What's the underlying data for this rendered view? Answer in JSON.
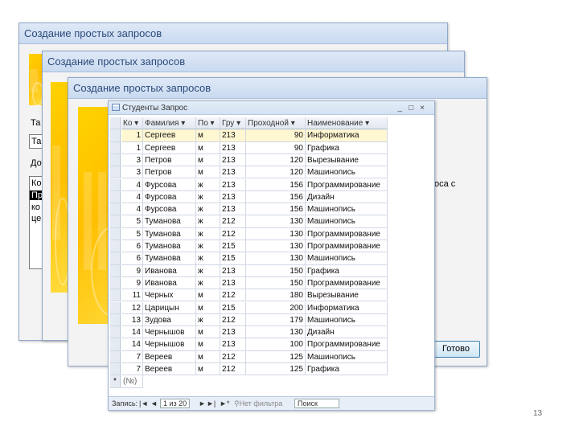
{
  "wizard": {
    "title": "Создание простых запросов",
    "finish_button": "Готово",
    "side_text": "оса с",
    "peek": [
      "Та",
      "Та",
      "До",
      "Ко",
      "Пр",
      "ко",
      "це"
    ]
  },
  "datasheet": {
    "title": "Студенты Запрос",
    "columns": [
      "Ко",
      "Фамилия",
      "По",
      "Гру",
      "Проходной",
      "Наименование"
    ],
    "rows": [
      {
        "k": "1",
        "fam": "Сергеев",
        "pol": "м",
        "grp": "213",
        "score": "90",
        "name": "Информатика"
      },
      {
        "k": "1",
        "fam": "Сергеев",
        "pol": "м",
        "grp": "213",
        "score": "90",
        "name": "Графика"
      },
      {
        "k": "3",
        "fam": "Петров",
        "pol": "м",
        "grp": "213",
        "score": "120",
        "name": "Вырезывание"
      },
      {
        "k": "3",
        "fam": "Петров",
        "pol": "м",
        "grp": "213",
        "score": "120",
        "name": "Машинопись"
      },
      {
        "k": "4",
        "fam": "Фурсова",
        "pol": "ж",
        "grp": "213",
        "score": "156",
        "name": "Программирование"
      },
      {
        "k": "4",
        "fam": "Фурсова",
        "pol": "ж",
        "grp": "213",
        "score": "156",
        "name": "Дизайн"
      },
      {
        "k": "4",
        "fam": "Фурсова",
        "pol": "ж",
        "grp": "213",
        "score": "156",
        "name": "Машинопись"
      },
      {
        "k": "5",
        "fam": "Туманова",
        "pol": "ж",
        "grp": "212",
        "score": "130",
        "name": "Машинопись"
      },
      {
        "k": "5",
        "fam": "Туманова",
        "pol": "ж",
        "grp": "212",
        "score": "130",
        "name": "Программирование"
      },
      {
        "k": "6",
        "fam": "Туманова",
        "pol": "ж",
        "grp": "215",
        "score": "130",
        "name": "Программирование"
      },
      {
        "k": "6",
        "fam": "Туманова",
        "pol": "ж",
        "grp": "215",
        "score": "130",
        "name": "Машинопись"
      },
      {
        "k": "9",
        "fam": "Иванова",
        "pol": "ж",
        "grp": "213",
        "score": "150",
        "name": "Графика"
      },
      {
        "k": "9",
        "fam": "Иванова",
        "pol": "ж",
        "grp": "213",
        "score": "150",
        "name": "Программирование"
      },
      {
        "k": "11",
        "fam": "Черных",
        "pol": "м",
        "grp": "212",
        "score": "180",
        "name": "Вырезывание"
      },
      {
        "k": "12",
        "fam": "Царицын",
        "pol": "м",
        "grp": "215",
        "score": "200",
        "name": "Информатика"
      },
      {
        "k": "13",
        "fam": "Зудова",
        "pol": "ж",
        "grp": "212",
        "score": "179",
        "name": "Машинопись"
      },
      {
        "k": "14",
        "fam": "Чернышов",
        "pol": "м",
        "grp": "213",
        "score": "130",
        "name": "Дизайн"
      },
      {
        "k": "14",
        "fam": "Чернышов",
        "pol": "м",
        "grp": "213",
        "score": "100",
        "name": "Программирование"
      },
      {
        "k": "7",
        "fam": "Вереев",
        "pol": "м",
        "grp": "212",
        "score": "125",
        "name": "Машинопись"
      },
      {
        "k": "7",
        "fam": "Вереев",
        "pol": "м",
        "grp": "212",
        "score": "125",
        "name": "Графика"
      }
    ],
    "new_row_marker": "(№)",
    "status": {
      "label": "Запись:",
      "first": "|◄",
      "prev": "◄",
      "position": "1 из 20",
      "next": "►",
      "last": "►|",
      "new": "►*",
      "filter": "Нет фильтра",
      "search": "Поиск"
    }
  },
  "slide_number": "13",
  "colors": {
    "accent": "#ffd200",
    "titlebar": "#d3e1f3",
    "button_border": "#3c7fb1"
  }
}
